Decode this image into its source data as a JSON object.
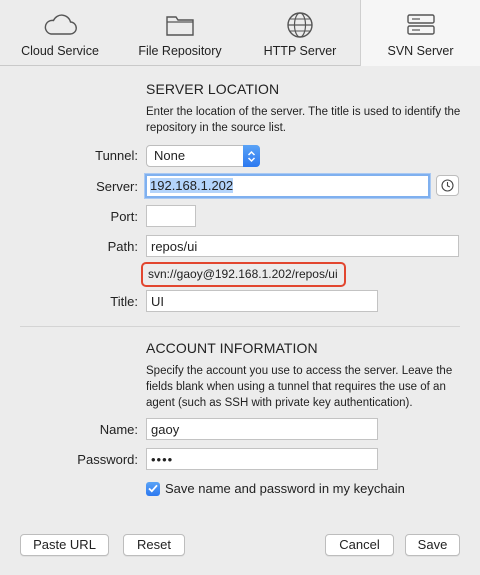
{
  "tabs": [
    {
      "label": "Cloud Service",
      "icon": "cloud-icon"
    },
    {
      "label": "File Repository",
      "icon": "folder-icon"
    },
    {
      "label": "HTTP Server",
      "icon": "globe-icon"
    },
    {
      "label": "SVN Server",
      "icon": "server-icon",
      "selected": true
    }
  ],
  "server_location": {
    "heading": "SERVER LOCATION",
    "description": "Enter the location of the server. The title is used to identify the repository in the source list.",
    "tunnel_label": "Tunnel:",
    "tunnel_value": "None",
    "server_label": "Server:",
    "server_value": "192.168.1.202",
    "port_label": "Port:",
    "port_value": "",
    "path_label": "Path:",
    "path_value": "repos/ui",
    "url_preview": "svn://gaoy@192.168.1.202/repos/ui",
    "title_label": "Title:",
    "title_value": "UI"
  },
  "account": {
    "heading": "ACCOUNT INFORMATION",
    "description": "Specify the account you use to access the server. Leave the fields blank when using a tunnel that requires the use of an agent (such as SSH with private key authentication).",
    "name_label": "Name:",
    "name_value": "gaoy",
    "password_label": "Password:",
    "password_value": "••••",
    "keychain_label": "Save name and password in my keychain",
    "keychain_checked": true
  },
  "buttons": {
    "paste_url": "Paste URL",
    "reset": "Reset",
    "cancel": "Cancel",
    "save": "Save"
  },
  "colors": {
    "accent": "#2c78f0",
    "highlight_border": "#e2462f",
    "focus_ring": "#7fb0ef"
  }
}
